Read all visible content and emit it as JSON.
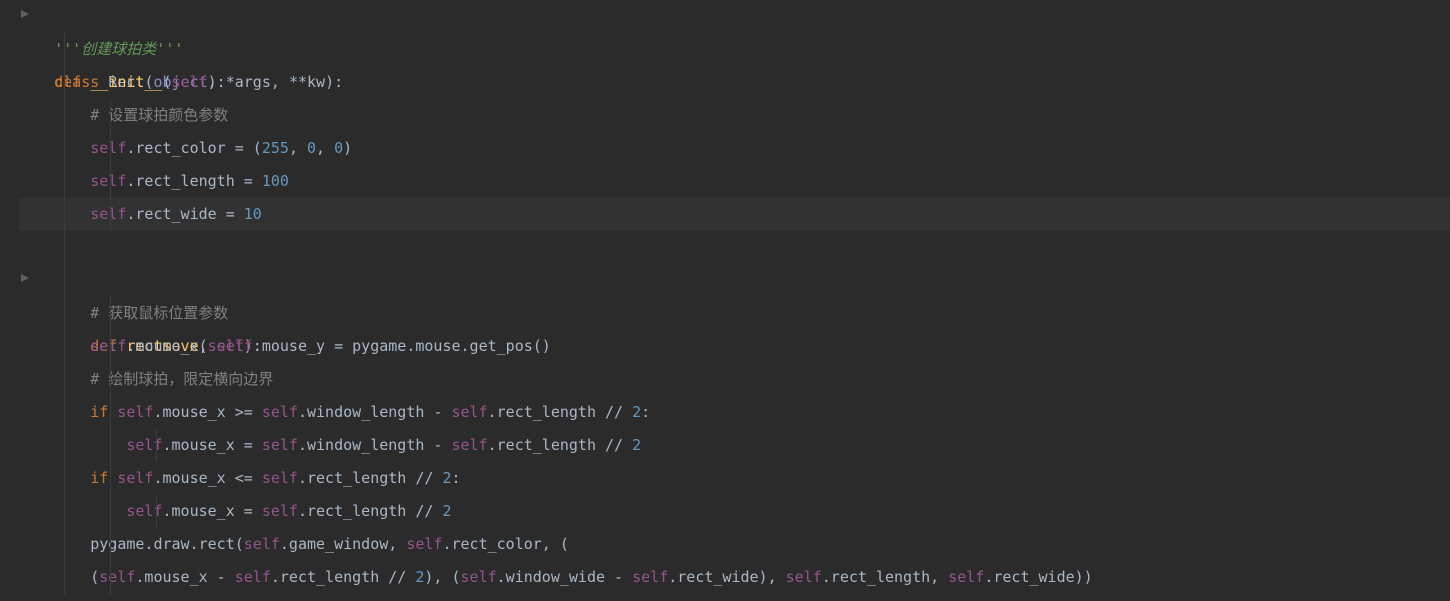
{
  "code": {
    "line1": {
      "kw": "class",
      "name": "Rect",
      "arg": "object"
    },
    "line2": {
      "doc": "'''创建球拍类'''"
    },
    "line3": {
      "kw": "def",
      "name": "__init__",
      "self": "self",
      "args": "*args",
      "kw2": "**kw"
    },
    "line4": {
      "cmt": "# 设置球拍颜色参数"
    },
    "line5": {
      "self": "self",
      "attr": ".rect_color = (",
      "n1": "255",
      "c1": ", ",
      "n2": "0",
      "c2": ", ",
      "n3": "0",
      "end": ")"
    },
    "line6": {
      "self": "self",
      "attr": ".rect_length = ",
      "n": "100"
    },
    "line7": {
      "self": "self",
      "attr": ".rect_wide = ",
      "n": "10"
    },
    "line9": {
      "kw": "def",
      "name": "rectmove",
      "self": "self"
    },
    "line10": {
      "cmt": "# 获取鼠标位置参数"
    },
    "line11": {
      "s1": "self",
      "a1": ".mouse_x, ",
      "s2": "self",
      "a2": ".mouse_y = pygame.mouse.get_pos()"
    },
    "line12": {
      "cmt": "# 绘制球拍，限定横向边界"
    },
    "line13": {
      "kw": "if",
      "s1": "self",
      "a1": ".mouse_x >= ",
      "s2": "self",
      "a2": ".window_length - ",
      "s3": "self",
      "a3": ".rect_length // ",
      "n": "2",
      "end": ":"
    },
    "line14": {
      "s1": "self",
      "a1": ".mouse_x = ",
      "s2": "self",
      "a2": ".window_length - ",
      "s3": "self",
      "a3": ".rect_length // ",
      "n": "2"
    },
    "line15": {
      "kw": "if",
      "s1": "self",
      "a1": ".mouse_x <= ",
      "s2": "self",
      "a2": ".rect_length // ",
      "n": "2",
      "end": ":"
    },
    "line16": {
      "s1": "self",
      "a1": ".mouse_x = ",
      "s2": "self",
      "a2": ".rect_length // ",
      "n": "2"
    },
    "line17": {
      "txt": "pygame.draw.rect(",
      "s1": "self",
      "a1": ".game_window, ",
      "s2": "self",
      "a2": ".rect_color, ("
    },
    "line18": {
      "p1": "(",
      "s1": "self",
      "a1": ".mouse_x - ",
      "s2": "self",
      "a2": ".rect_length // ",
      "n1": "2",
      "p2": "), (",
      "s3": "self",
      "a3": ".window_wide - ",
      "s4": "self",
      "a4": ".rect_wide), ",
      "s5": "self",
      "a5": ".rect_length, ",
      "s6": "self",
      "a6": ".rect_wide))"
    }
  }
}
